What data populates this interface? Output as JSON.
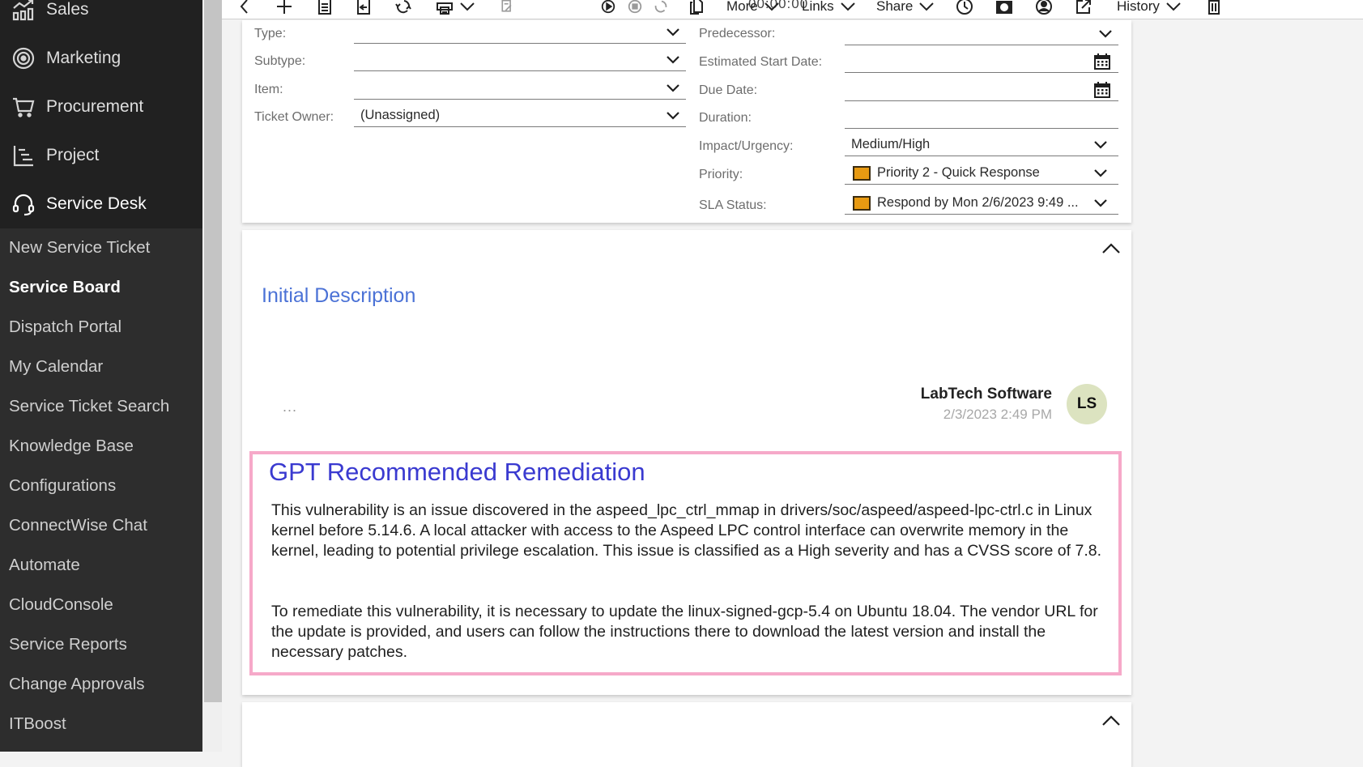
{
  "sidebar": {
    "modules": [
      {
        "label": "Sales",
        "icon": "sales-chart-icon"
      },
      {
        "label": "Marketing",
        "icon": "target-icon"
      },
      {
        "label": "Procurement",
        "icon": "cart-icon"
      },
      {
        "label": "Project",
        "icon": "project-gantt-icon"
      },
      {
        "label": "Service Desk",
        "icon": "headset-icon",
        "active": true
      }
    ],
    "items": [
      {
        "label": "New Service Ticket"
      },
      {
        "label": "Service Board",
        "active": true
      },
      {
        "label": "Dispatch Portal"
      },
      {
        "label": "My Calendar"
      },
      {
        "label": "Service Ticket Search"
      },
      {
        "label": "Knowledge Base"
      },
      {
        "label": "Configurations"
      },
      {
        "label": "ConnectWise Chat"
      },
      {
        "label": "Automate"
      },
      {
        "label": "CloudConsole"
      },
      {
        "label": "Service Reports"
      },
      {
        "label": "Change Approvals"
      },
      {
        "label": "ITBoost"
      }
    ]
  },
  "toolbar": {
    "timer": "00:00:00",
    "more_label": "More",
    "links_label": "Links",
    "share_label": "Share",
    "history_label": "History"
  },
  "ticket_form": {
    "left": [
      {
        "label": "Type:",
        "value": ""
      },
      {
        "label": "Subtype:",
        "value": ""
      },
      {
        "label": "Item:",
        "value": ""
      },
      {
        "label": "Ticket Owner:",
        "value": "(Unassigned)"
      }
    ],
    "right": [
      {
        "label": "Predecessor:",
        "value": ""
      },
      {
        "label": "Estimated Start Date:",
        "value": ""
      },
      {
        "label": "Due Date:",
        "value": ""
      },
      {
        "label": "Duration:",
        "value": ""
      },
      {
        "label": "Impact/Urgency:",
        "value": "Medium/High"
      },
      {
        "label": "Priority:",
        "value": "Priority 2 - Quick Response",
        "color": "#e89a12"
      },
      {
        "label": "SLA Status:",
        "value": "Respond by Mon 2/6/2023 9:49 ...",
        "color": "#e89a12"
      }
    ]
  },
  "initial_description": {
    "title": "Initial Description",
    "more": "...",
    "author": "LabTech Software",
    "timestamp": "2/3/2023 2:49 PM",
    "avatar_initials": "LS",
    "gpt": {
      "title": "GPT Recommended Remediation",
      "paragraph1": "This vulnerability is an issue discovered in the aspeed_lpc_ctrl_mmap in drivers/soc/aspeed/aspeed-lpc-ctrl.c in Linux kernel before 5.14.6. A local attacker with access to the Aspeed LPC control interface can overwrite memory in the kernel, leading to potential privilege escalation. This issue is classified as a High severity and has a CVSS score of 7.8.",
      "paragraph2": "To remediate this vulnerability, it is necessary to update the linux-signed-gcp-5.4 on Ubuntu 18.04. The vendor URL for the update is provided, and users can follow the instructions there to download the latest version and install the necessary patches."
    }
  },
  "colors": {
    "accent_blue": "#4b72d6",
    "gpt_title": "#3a3ad0",
    "highlight_border": "#f6a9c9",
    "priority_orange": "#e89a12",
    "avatar_bg": "#dce3c0"
  }
}
